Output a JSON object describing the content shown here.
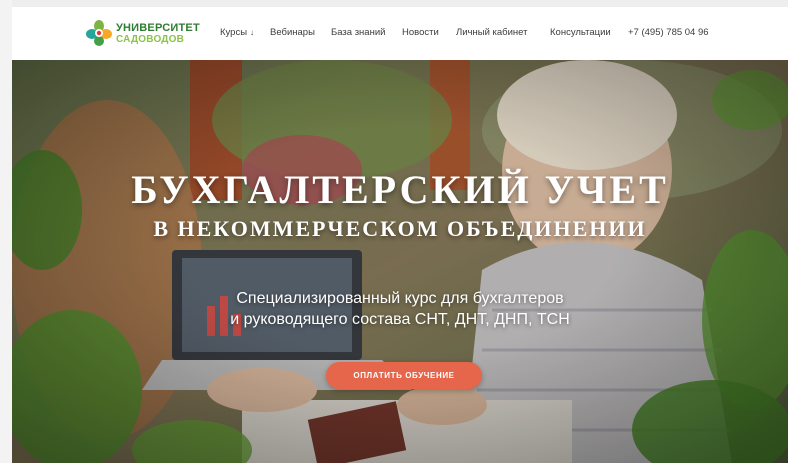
{
  "header": {
    "logo": {
      "line1": "УНИВЕРСИТЕТ",
      "line2": "САДОВОДОВ",
      "icon": "flower-leaf-logo-icon"
    },
    "nav": [
      {
        "label": "Курсы",
        "has_dropdown": true
      },
      {
        "label": "Вебинары"
      },
      {
        "label": "База знаний"
      },
      {
        "label": "Новости"
      },
      {
        "label": "Личный кабинет"
      },
      {
        "label": "Консультации"
      },
      {
        "label": "+7 (495) 785 04 96"
      }
    ],
    "dropdown_arrow": "↓"
  },
  "hero": {
    "title": "БУХГАЛТЕРСКИЙ УЧЕТ",
    "subtitle": "В НЕКОММЕРЧЕСКОМ ОБЪЕДИНЕНИИ",
    "desc_line1": "Специализированный курс для бухгалтеров",
    "desc_line2": "и руководящего состава СНТ, ДНТ, ДНП, ТСН",
    "cta_label": "ОПЛАТИТЬ ОБУЧЕНИЕ"
  },
  "colors": {
    "brand_green": "#2e7d32",
    "brand_light_green": "#8bc34a",
    "cta": "#e5664a",
    "nav_text": "#3c3c3c"
  }
}
